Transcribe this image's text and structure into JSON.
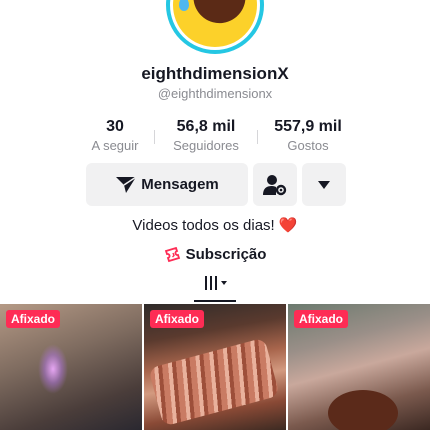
{
  "profile": {
    "username": "eighthdimensionX",
    "handle": "@eighthdimensionx",
    "bio": "Videos todos os dias!",
    "bio_emoji": "❤️"
  },
  "stats": [
    {
      "value": "30",
      "label": "A seguir"
    },
    {
      "value": "56,8 mil",
      "label": "Seguidores"
    },
    {
      "value": "557,9 mil",
      "label": "Gostos"
    }
  ],
  "actions": {
    "message_label": "Mensagem",
    "add_friend_icon": "person-gear-icon",
    "more_icon": "triangle-down-icon"
  },
  "subscription": {
    "label": "Subscrição",
    "icon": "ticket-icon",
    "icon_color": "#fe2c55"
  },
  "grid": {
    "items": [
      {
        "badge": "Afixado"
      },
      {
        "badge": "Afixado"
      },
      {
        "badge": "Afixado"
      }
    ]
  },
  "colors": {
    "accent": "#fe2c55",
    "text_primary": "#161823",
    "text_secondary": "#8a8b91",
    "avatar_ring": "#25c7e3"
  }
}
